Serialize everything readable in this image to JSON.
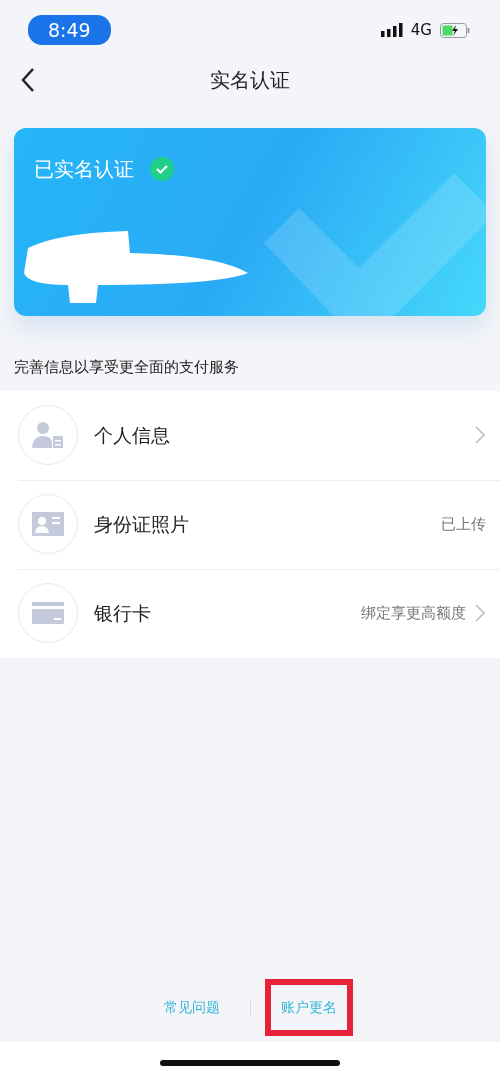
{
  "status_bar": {
    "time": "8:49",
    "network": "4G"
  },
  "nav": {
    "title": "实名认证"
  },
  "card": {
    "label": "已实名认证",
    "verified": true
  },
  "subtitle": "完善信息以享受更全面的支付服务",
  "items": [
    {
      "kind": "person",
      "label": "个人信息",
      "chevron": true
    },
    {
      "kind": "id-card",
      "label": "身份证照片",
      "value": "已上传",
      "chevron": false
    },
    {
      "kind": "bank-card",
      "label": "银行卡",
      "value": "绑定享更高额度",
      "chevron": true
    }
  ],
  "footer_links": [
    {
      "label": "常见问题",
      "highlighted": false
    },
    {
      "label": "账户更名",
      "highlighted": true
    }
  ]
}
